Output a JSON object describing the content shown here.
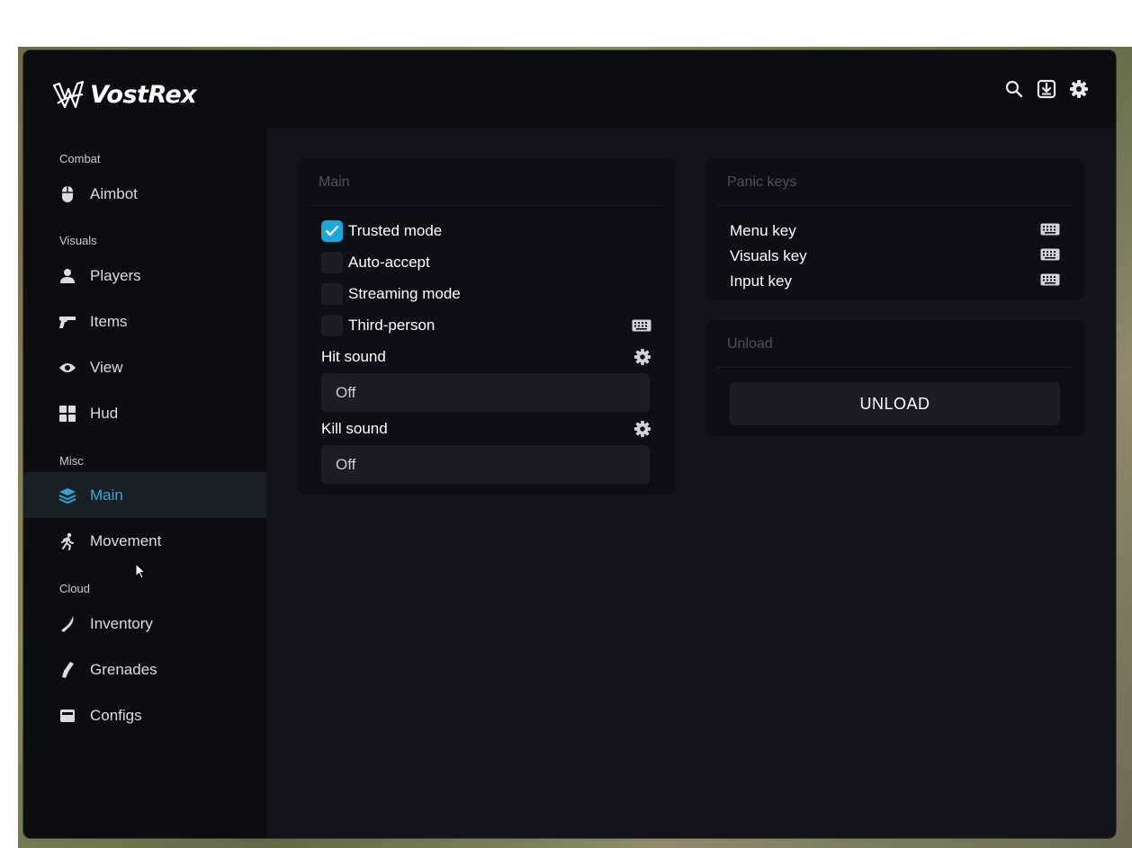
{
  "app": {
    "brand": "VostRex"
  },
  "sidebar": {
    "sections": [
      {
        "title": "Combat",
        "items": [
          {
            "label": "Aimbot",
            "icon": "mouse-icon"
          }
        ]
      },
      {
        "title": "Visuals",
        "items": [
          {
            "label": "Players",
            "icon": "user-icon"
          },
          {
            "label": "Items",
            "icon": "pistol-icon"
          },
          {
            "label": "View",
            "icon": "eye-icon"
          },
          {
            "label": "Hud",
            "icon": "grid-icon"
          }
        ]
      },
      {
        "title": "Misc",
        "items": [
          {
            "label": "Main",
            "icon": "layers-icon",
            "active": true
          },
          {
            "label": "Movement",
            "icon": "running-icon"
          }
        ]
      },
      {
        "title": "Cloud",
        "items": [
          {
            "label": "Inventory",
            "icon": "knife-icon"
          },
          {
            "label": "Grenades",
            "icon": "grenade-icon"
          },
          {
            "label": "Configs",
            "icon": "archive-icon"
          }
        ]
      }
    ]
  },
  "toolbar": {
    "icons": [
      "search-icon",
      "download-icon",
      "gear-icon"
    ]
  },
  "main_panel": {
    "title": "Main",
    "checkboxes": [
      {
        "label": "Trusted mode",
        "checked": true
      },
      {
        "label": "Auto-accept",
        "checked": false
      },
      {
        "label": "Streaming mode",
        "checked": false
      },
      {
        "label": "Third-person",
        "checked": false,
        "trailing_icon": "keyboard-icon"
      }
    ],
    "hit_sound": {
      "label": "Hit sound",
      "value": "Off"
    },
    "kill_sound": {
      "label": "Kill sound",
      "value": "Off"
    }
  },
  "panic_panel": {
    "title": "Panic keys",
    "keys": [
      {
        "label": "Menu key"
      },
      {
        "label": "Visuals key"
      },
      {
        "label": "Input key"
      }
    ]
  },
  "unload_panel": {
    "title": "Unload",
    "button_label": "UNLOAD"
  },
  "colors": {
    "accent": "#19a7dd",
    "background": "#111419",
    "sidebar": "#0b0e11",
    "panel": "#0c0f13",
    "control": "#1a1e24"
  }
}
